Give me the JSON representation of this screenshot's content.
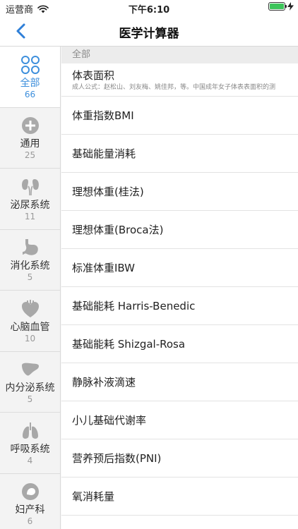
{
  "status": {
    "carrier": "运营商",
    "time": "下午6:10"
  },
  "nav": {
    "title": "医学计算器"
  },
  "sidebar": {
    "items": [
      {
        "label": "全部",
        "count": "66",
        "icon": "grid-icon",
        "active": true
      },
      {
        "label": "通用",
        "count": "25",
        "icon": "plus-circle-icon"
      },
      {
        "label": "泌尿系统",
        "count": "11",
        "icon": "kidney-icon"
      },
      {
        "label": "消化系统",
        "count": "5",
        "icon": "stomach-icon"
      },
      {
        "label": "心脑血管",
        "count": "10",
        "icon": "heart-icon"
      },
      {
        "label": "内分泌系统",
        "count": "5",
        "icon": "liver-icon"
      },
      {
        "label": "呼吸系统",
        "count": "4",
        "icon": "lungs-icon"
      },
      {
        "label": "妇产科",
        "count": "6",
        "icon": "uterus-icon"
      }
    ]
  },
  "content": {
    "section": "全部",
    "items": [
      {
        "title": "体表面积",
        "subtitle": "成人公式：赵松山、刘友梅、姚佳邦，等。中国成年女子体表表面积的测"
      },
      {
        "title": "体重指数BMI"
      },
      {
        "title": "基础能量消耗"
      },
      {
        "title": "理想体重(桂法)"
      },
      {
        "title": "理想体重(Broca法)"
      },
      {
        "title": "标准体重IBW"
      },
      {
        "title": "基础能耗 Harris-Benedic"
      },
      {
        "title": "基础能耗 Shizgal-Rosa"
      },
      {
        "title": "静脉补液滴速"
      },
      {
        "title": "小儿基础代谢率"
      },
      {
        "title": "营养预后指数(PNI)"
      },
      {
        "title": "氧消耗量"
      }
    ]
  },
  "colors": {
    "accent": "#3d8fdc",
    "battery": "#3cc45a"
  }
}
